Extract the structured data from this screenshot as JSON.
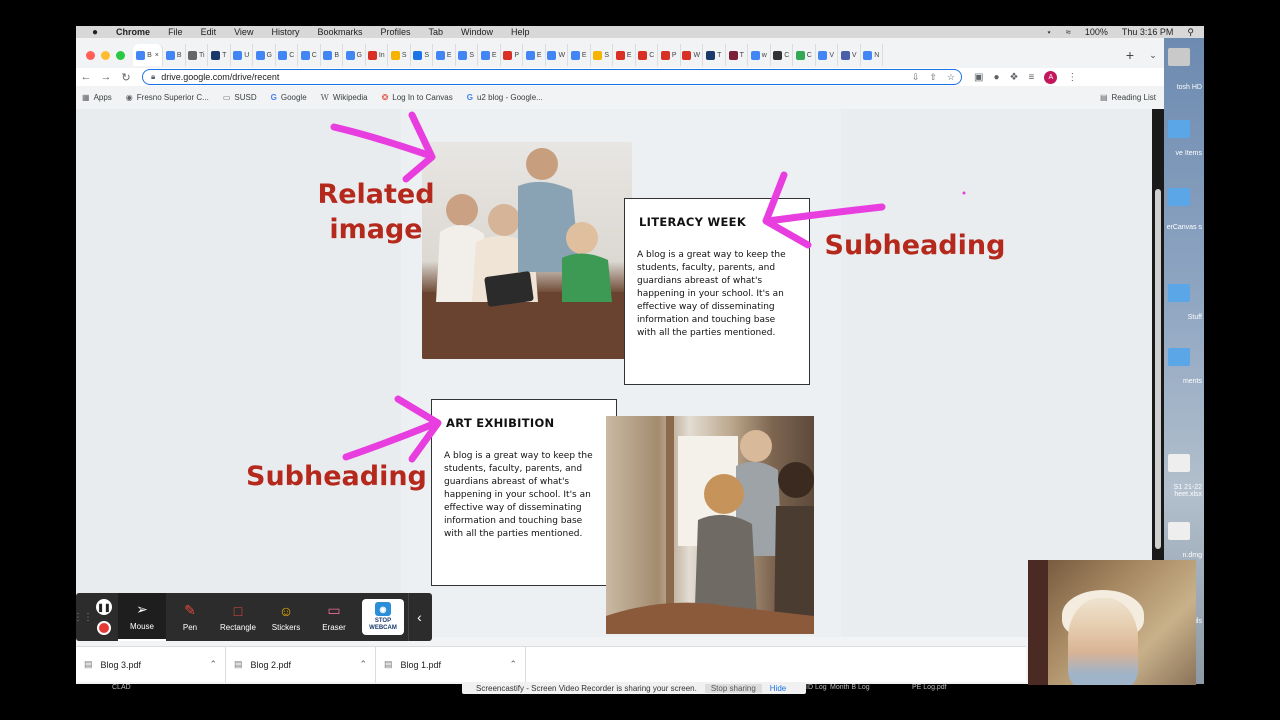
{
  "menubar": {
    "apple": "",
    "items": [
      "Chrome",
      "File",
      "Edit",
      "View",
      "History",
      "Bookmarks",
      "Profiles",
      "Tab",
      "Window",
      "Help"
    ],
    "battery": "100%",
    "clock": "Thu 3:16 PM"
  },
  "tabs": [
    {
      "letter": "B",
      "color": "#4285f4",
      "active": true
    },
    {
      "letter": "B",
      "color": "#4285f4"
    },
    {
      "letter": "Ti",
      "color": "#666666"
    },
    {
      "letter": "T",
      "color": "#1b3a6b"
    },
    {
      "letter": "U",
      "color": "#4285f4"
    },
    {
      "letter": "G",
      "color": "#4285f4"
    },
    {
      "letter": "C",
      "color": "#4285f4"
    },
    {
      "letter": "C",
      "color": "#4285f4"
    },
    {
      "letter": "B",
      "color": "#4285f4"
    },
    {
      "letter": "G",
      "color": "#4285f4"
    },
    {
      "letter": "In",
      "color": "#d93025"
    },
    {
      "letter": "S",
      "color": "#f4b400"
    },
    {
      "letter": "S",
      "color": "#1a73e8"
    },
    {
      "letter": "E",
      "color": "#4285f4"
    },
    {
      "letter": "S",
      "color": "#4285f4"
    },
    {
      "letter": "E",
      "color": "#4285f4"
    },
    {
      "letter": "P",
      "color": "#d93025"
    },
    {
      "letter": "E",
      "color": "#4285f4"
    },
    {
      "letter": "W",
      "color": "#4285f4"
    },
    {
      "letter": "E",
      "color": "#4285f4"
    },
    {
      "letter": "S",
      "color": "#f4b400"
    },
    {
      "letter": "E",
      "color": "#d93025"
    },
    {
      "letter": "C",
      "color": "#d93025"
    },
    {
      "letter": "P",
      "color": "#d93025"
    },
    {
      "letter": "W",
      "color": "#d93025"
    },
    {
      "letter": "T",
      "color": "#1b3a6b"
    },
    {
      "letter": "T",
      "color": "#7b1f3a"
    },
    {
      "letter": "w",
      "color": "#4285f4"
    },
    {
      "letter": "C",
      "color": "#333333"
    },
    {
      "letter": "C",
      "color": "#34a853"
    },
    {
      "letter": "V",
      "color": "#4285f4"
    },
    {
      "letter": "V",
      "color": "#4b5ea8"
    },
    {
      "letter": "N",
      "color": "#4285f4"
    }
  ],
  "toolbar": {
    "back": "←",
    "forward": "→",
    "reload": "↻",
    "url": "drive.google.com/drive/recent",
    "profile_initial": "A"
  },
  "bookmarks": {
    "items": [
      {
        "label": "Apps",
        "icon": "grid-icon"
      },
      {
        "label": "Fresno Superior C...",
        "icon": "seal-icon"
      },
      {
        "label": "SUSD",
        "icon": "folder-icon"
      },
      {
        "label": "Google",
        "icon": "google-icon"
      },
      {
        "label": "Wikipedia",
        "icon": "wikipedia-icon"
      },
      {
        "label": "Log In to Canvas",
        "icon": "canvas-icon"
      },
      {
        "label": "u2 blog - Google...",
        "icon": "google-icon"
      }
    ],
    "reading_list": "Reading List"
  },
  "page": {
    "annotations": {
      "related_image": "Related\nimage",
      "subheading_1": "Subheading",
      "subheading_2": "Subheading"
    },
    "cards": {
      "literacy": {
        "title": "LITERACY WEEK",
        "body": "A blog is a great way to keep the students, faculty, parents, and guardians abreast of what's happening in your school. It's an effective way of disseminating information and touching base with all the parties mentioned."
      },
      "art": {
        "title": "ART EXHIBITION",
        "body": "A blog is a great way to keep the students, faculty, parents, and guardians abreast of what's happening in your school. It's an effective way of disseminating information and touching base with all the parties mentioned."
      }
    }
  },
  "screencastify": {
    "tools": [
      {
        "label": "Mouse",
        "icon": "cursor-icon",
        "active": true
      },
      {
        "label": "Pen",
        "icon": "pen-icon"
      },
      {
        "label": "Rectangle",
        "icon": "rectangle-icon"
      },
      {
        "label": "Stickers",
        "icon": "sticker-icon"
      },
      {
        "label": "Eraser",
        "icon": "eraser-icon"
      }
    ],
    "webcam_label": "STOP\nWEBCAM"
  },
  "downloads": [
    {
      "name": "Blog 3.pdf"
    },
    {
      "name": "Blog 2.pdf"
    },
    {
      "name": "Blog 1.pdf"
    }
  ],
  "sharebar": {
    "text": "Screencastify - Screen Video Recorder is sharing your screen.",
    "stop": "Stop sharing",
    "hide": "Hide"
  },
  "desktop": {
    "labels": [
      "tosh HD",
      "ve Items",
      "erCanvas s",
      "Stuff",
      "ments",
      "S1 21-22 heet.xlsx",
      "n.dmg",
      "ils"
    ],
    "bottom_labels": [
      "CLAD",
      "Month B Log",
      "PE Log.pdf",
      "ID Log"
    ]
  },
  "colors": {
    "annotation_red": "#b5281c",
    "arrow_magenta": "#e83ee0",
    "omnibox_focus": "#1a73e8"
  }
}
